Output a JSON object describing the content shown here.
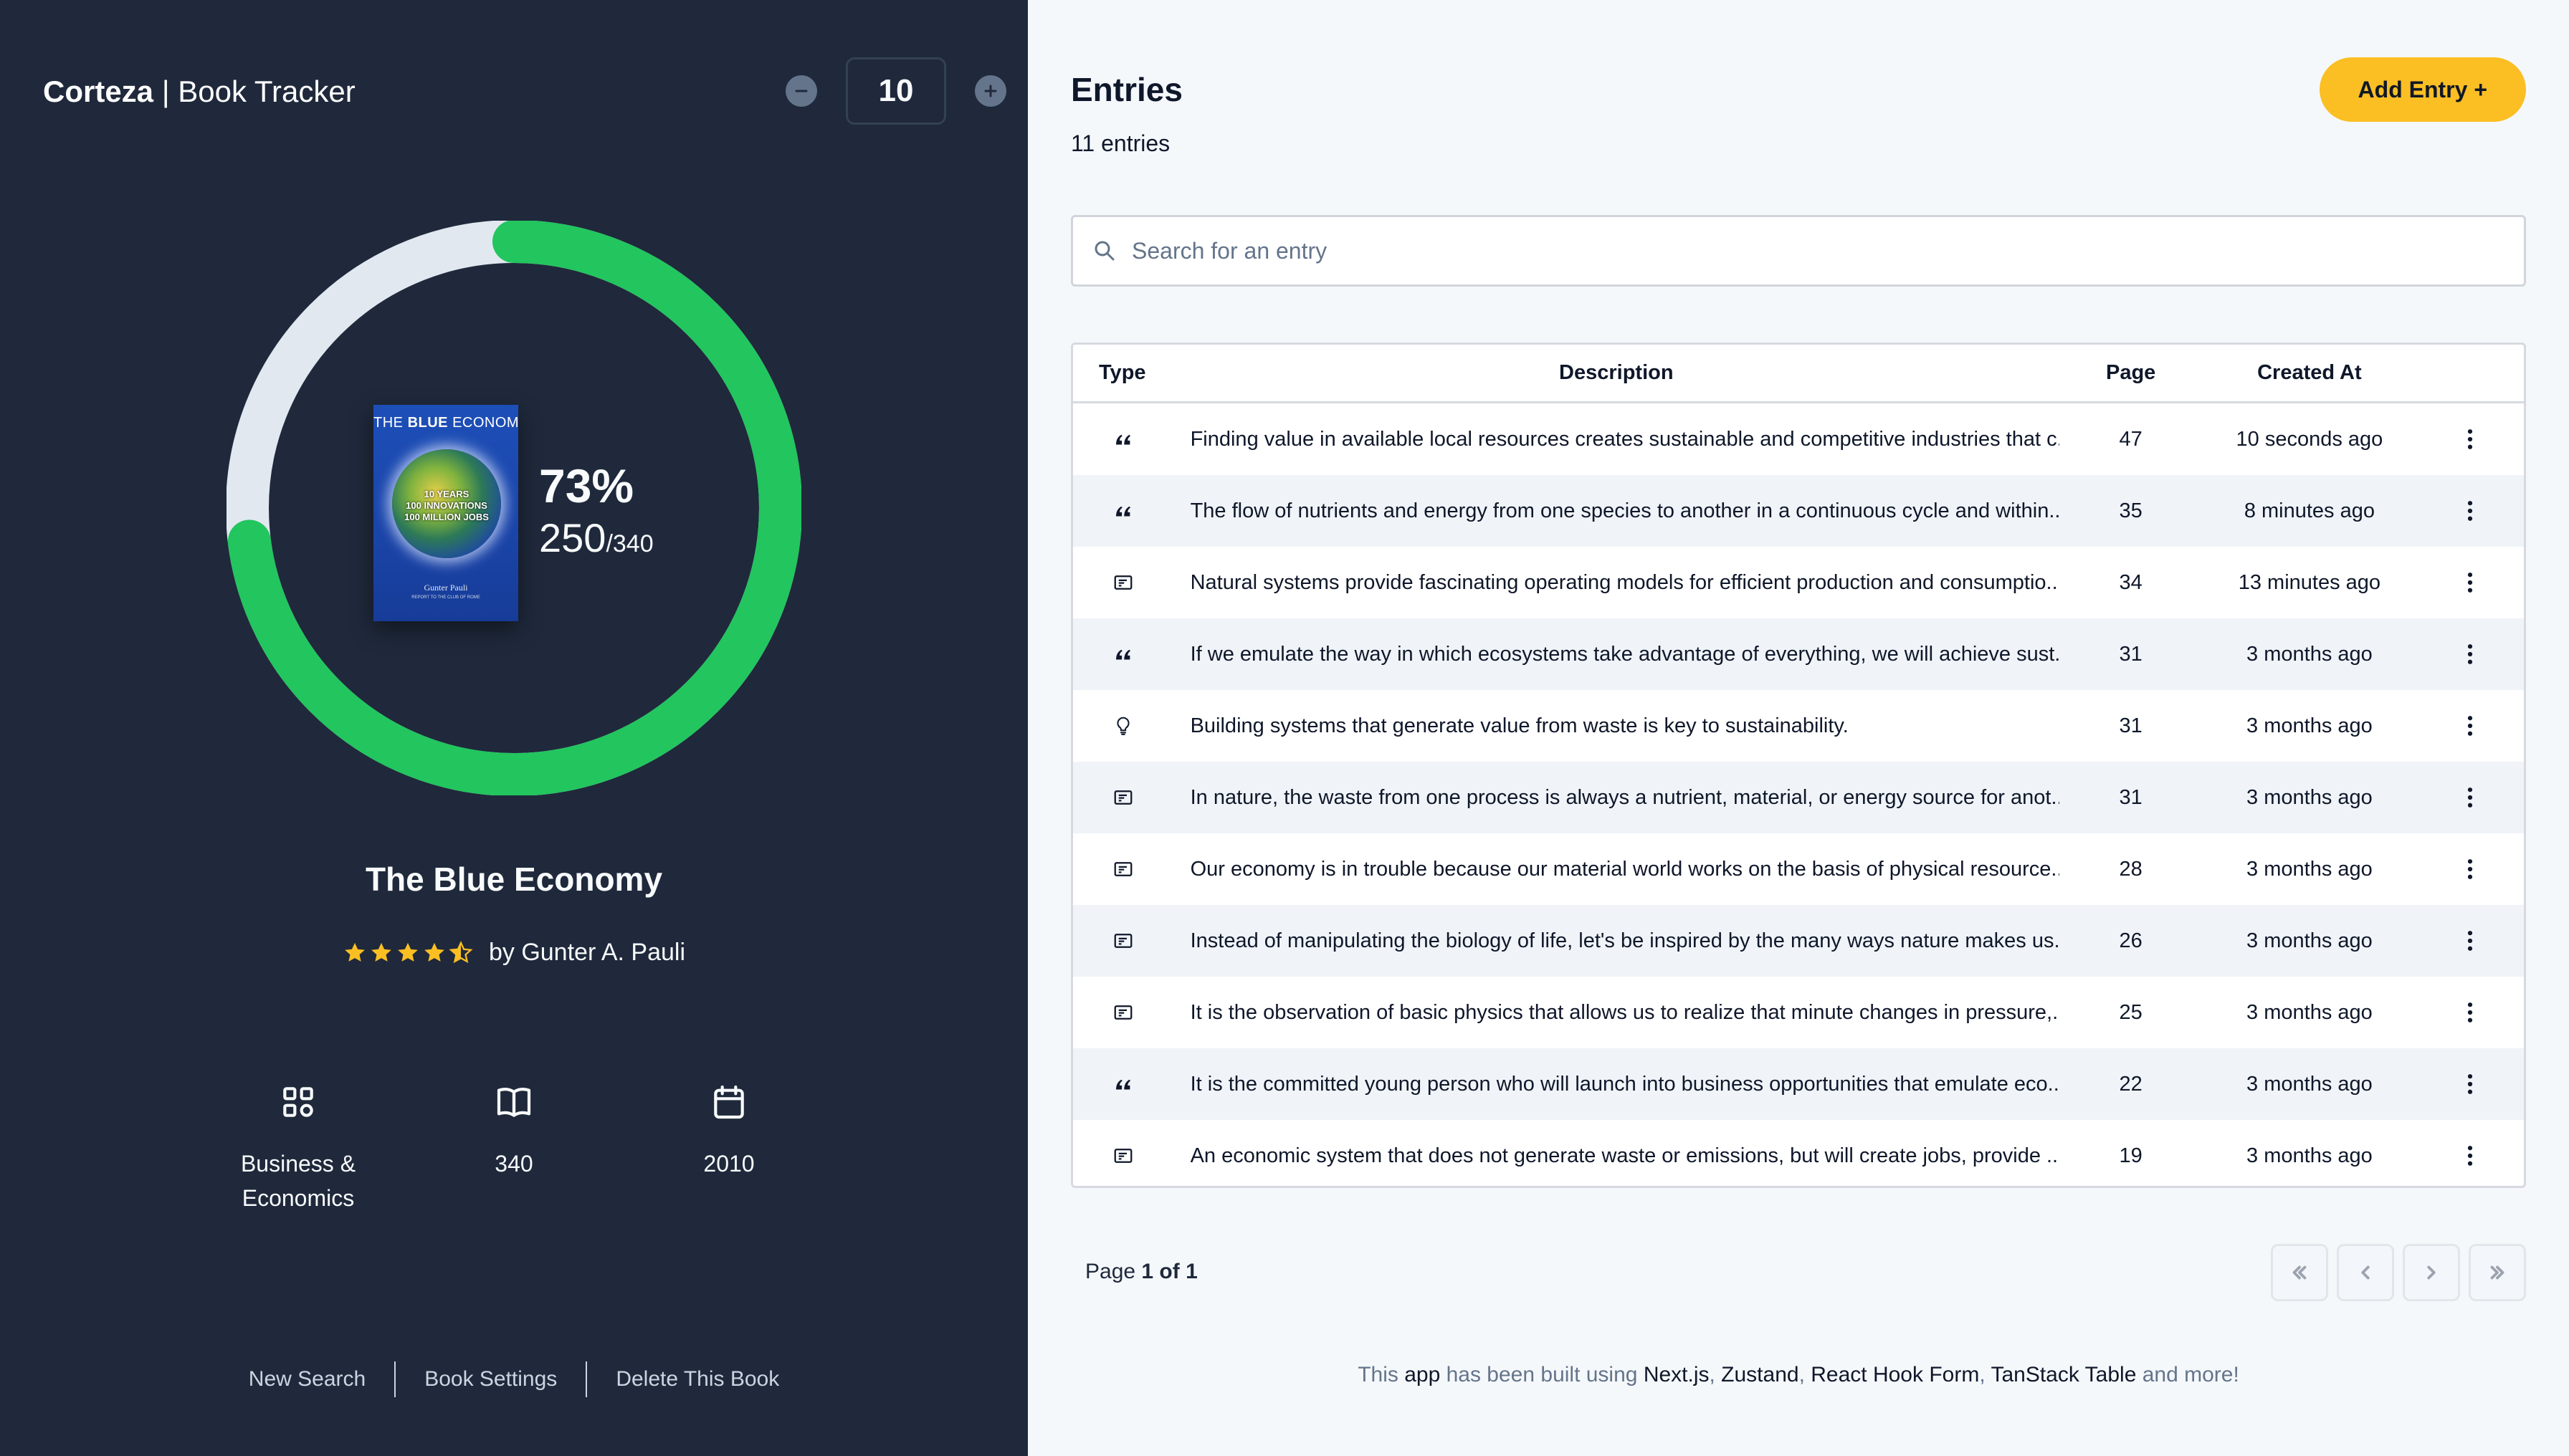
{
  "header": {
    "brand_bold": "Corteza",
    "brand_rest": " | Book Tracker",
    "stepper_value": "10"
  },
  "book": {
    "title": "The Blue Economy",
    "author": "by Gunter A. Pauli",
    "rating": 4.5,
    "rating_max": 5,
    "progress_percent": "73%",
    "progress_fraction": 0.73,
    "pages_read": "250",
    "pages_total": "/340",
    "cover": {
      "title_light": "THE ",
      "title_bold": "BLUE",
      "title_rest": " ECONOMY",
      "line1": "10 YEARS",
      "line2": "100 INNOVATIONS",
      "line3": "100 MILLION JOBS",
      "author": "Gunter Pauli",
      "subtitle": "REPORT TO THE CLUB OF ROME"
    },
    "meta": {
      "category_line1": "Business &",
      "category_line2": "Economics",
      "pages": "340",
      "year": "2010"
    }
  },
  "left_links": {
    "new_search": "New Search",
    "book_settings": "Book Settings",
    "delete_book": "Delete This Book"
  },
  "entries": {
    "title": "Entries",
    "count": "11 entries",
    "add_button": "Add Entry +",
    "search_placeholder": "Search for an entry",
    "search_value": ""
  },
  "table": {
    "headers": {
      "type": "Type",
      "description": "Description",
      "page": "Page",
      "created": "Created At"
    },
    "rows": [
      {
        "type": "quote",
        "description": "Finding value in available local resources creates sustainable and competitive industries that c...",
        "page": "47",
        "created": "10 seconds ago"
      },
      {
        "type": "quote",
        "description": "The flow of nutrients and energy from one species to another in a continuous cycle and within...",
        "page": "35",
        "created": "8 minutes ago"
      },
      {
        "type": "note",
        "description": "Natural systems provide fascinating operating models for efficient production and consumptio...",
        "page": "34",
        "created": "13 minutes ago"
      },
      {
        "type": "quote",
        "description": "If we emulate the way in which ecosystems take advantage of everything, we will achieve sust...",
        "page": "31",
        "created": "3 months ago"
      },
      {
        "type": "idea",
        "description": "Building systems that generate value from waste is key to sustainability.",
        "page": "31",
        "created": "3 months ago"
      },
      {
        "type": "note",
        "description": "In nature, the waste from one process is always a nutrient, material, or energy source for anot...",
        "page": "31",
        "created": "3 months ago"
      },
      {
        "type": "note",
        "description": "Our economy is in trouble because our material world works on the basis of physical resource...",
        "page": "28",
        "created": "3 months ago"
      },
      {
        "type": "note",
        "description": "Instead of manipulating the biology of life, let's be inspired by the many ways nature makes us...",
        "page": "26",
        "created": "3 months ago"
      },
      {
        "type": "note",
        "description": "It is the observation of basic physics that allows us to realize that minute changes in pressure,...",
        "page": "25",
        "created": "3 months ago"
      },
      {
        "type": "quote",
        "description": "It is the committed young person who will launch into business opportunities that emulate eco...",
        "page": "22",
        "created": "3 months ago"
      },
      {
        "type": "note",
        "description": "An economic system that does not generate waste or emissions, but will create jobs, provide ...",
        "page": "19",
        "created": "3 months ago"
      }
    ]
  },
  "pagination": {
    "label": "Page ",
    "current": "1 of 1"
  },
  "footer": {
    "parts": [
      {
        "text": "This ",
        "hl": false
      },
      {
        "text": "app",
        "hl": true
      },
      {
        "text": " has been built using ",
        "hl": false
      },
      {
        "text": "Next.js",
        "hl": true
      },
      {
        "text": ", ",
        "hl": false
      },
      {
        "text": "Zustand",
        "hl": true
      },
      {
        "text": ", ",
        "hl": false
      },
      {
        "text": "React Hook Form",
        "hl": true
      },
      {
        "text": ", ",
        "hl": false
      },
      {
        "text": "TanStack Table",
        "hl": true
      },
      {
        "text": " and more!",
        "hl": false
      }
    ]
  },
  "colors": {
    "sidebar_bg": "#1f293b",
    "progress": "#22c55e",
    "track": "#e2e8f0",
    "accent": "#fbbf24",
    "star": "#fbbf24"
  }
}
